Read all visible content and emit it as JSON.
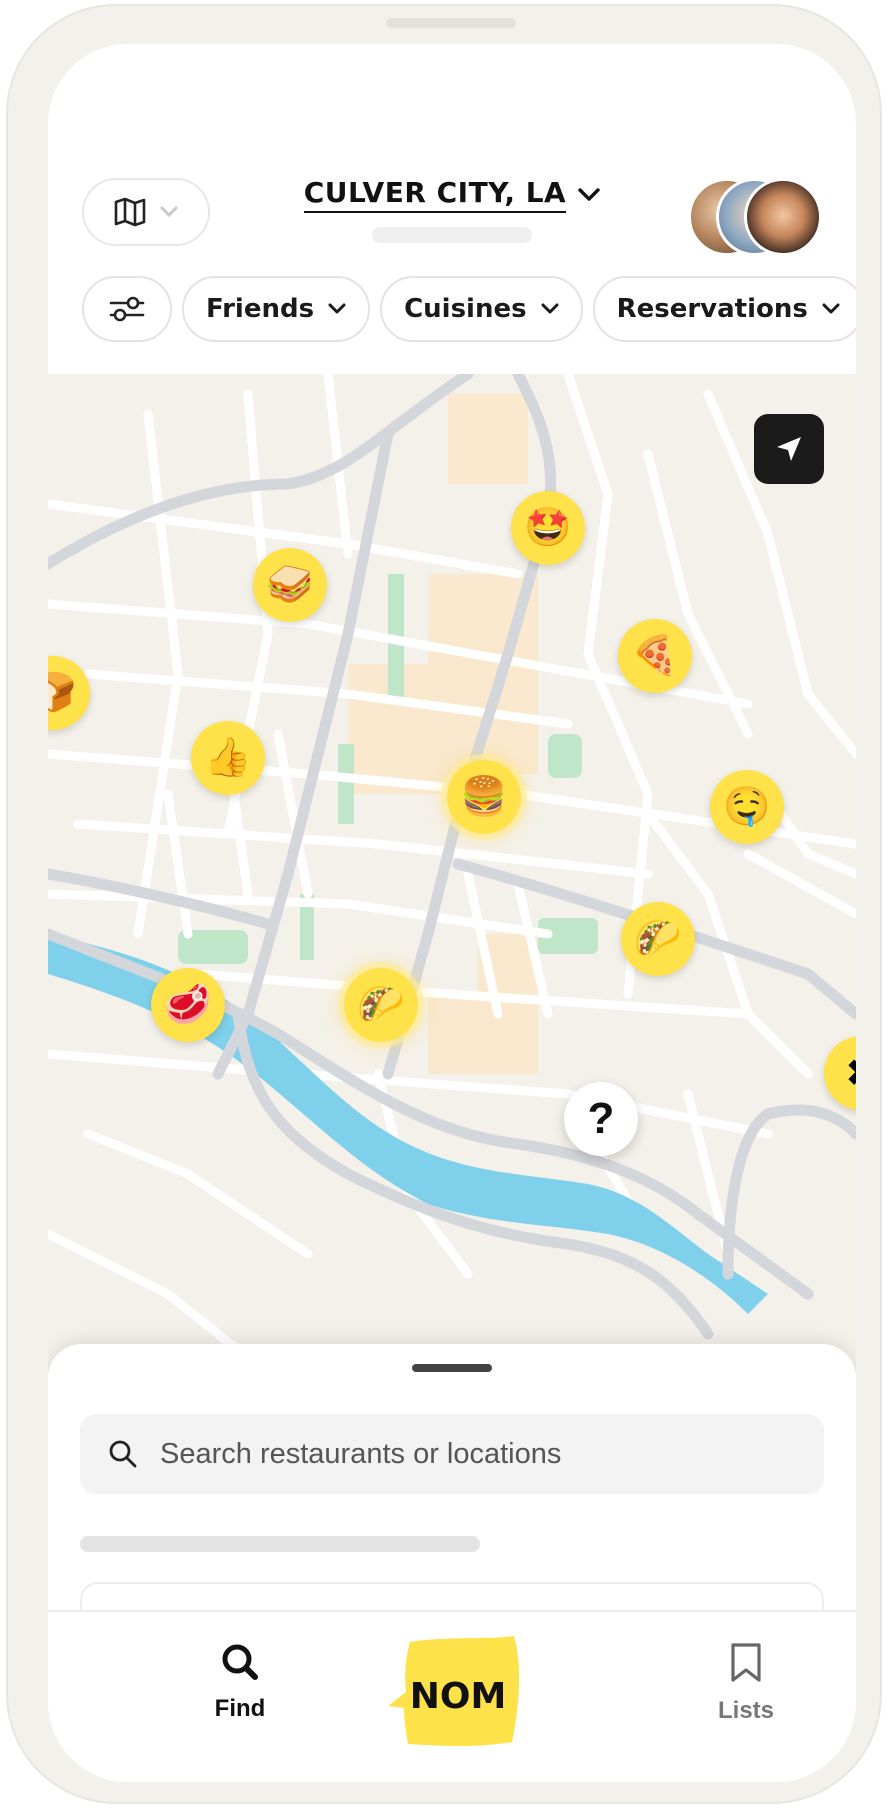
{
  "header": {
    "location_title": "CULVER CITY, LA",
    "map_toggle_icon": "map-icon",
    "dropdown_icon": "chevron-down-icon"
  },
  "filters": {
    "settings_icon": "sliders-icon",
    "chips": [
      {
        "label": "Friends"
      },
      {
        "label": "Cuisines"
      },
      {
        "label": "Reservations"
      }
    ]
  },
  "map": {
    "locate_icon": "navigation-arrow-icon",
    "pins": [
      {
        "icon": "star-struck-emoji",
        "glyph": "🤩"
      },
      {
        "icon": "sandwich-icon",
        "glyph": "🥪"
      },
      {
        "icon": "pizza-icon",
        "glyph": "🍕"
      },
      {
        "icon": "bread-icon",
        "glyph": "🍞"
      },
      {
        "icon": "thumbs-up-emoji",
        "glyph": "👍"
      },
      {
        "icon": "burger-icon",
        "glyph": "🍔"
      },
      {
        "icon": "drooling-face-emoji",
        "glyph": "🤤"
      },
      {
        "icon": "taco-icon",
        "glyph": "🌮"
      },
      {
        "icon": "taco-icon",
        "glyph": "🌮"
      },
      {
        "icon": "steak-icon",
        "glyph": "🥩"
      },
      {
        "icon": "unknown-place-icon",
        "glyph": "?"
      },
      {
        "icon": "partial-pin-icon",
        "glyph": "✖"
      }
    ]
  },
  "search": {
    "placeholder": "Search restaurants or locations",
    "icon": "search-icon"
  },
  "tabbar": {
    "find_label": "Find",
    "lists_label": "Lists",
    "logo_text": "NOM"
  },
  "colors": {
    "accent_yellow": "#ffe14a",
    "map_background": "#f4f1ea",
    "river": "#7fd0ea",
    "park": "#bfe6c9",
    "road_major": "#d3d6da",
    "dark": "#1b1b1b"
  }
}
